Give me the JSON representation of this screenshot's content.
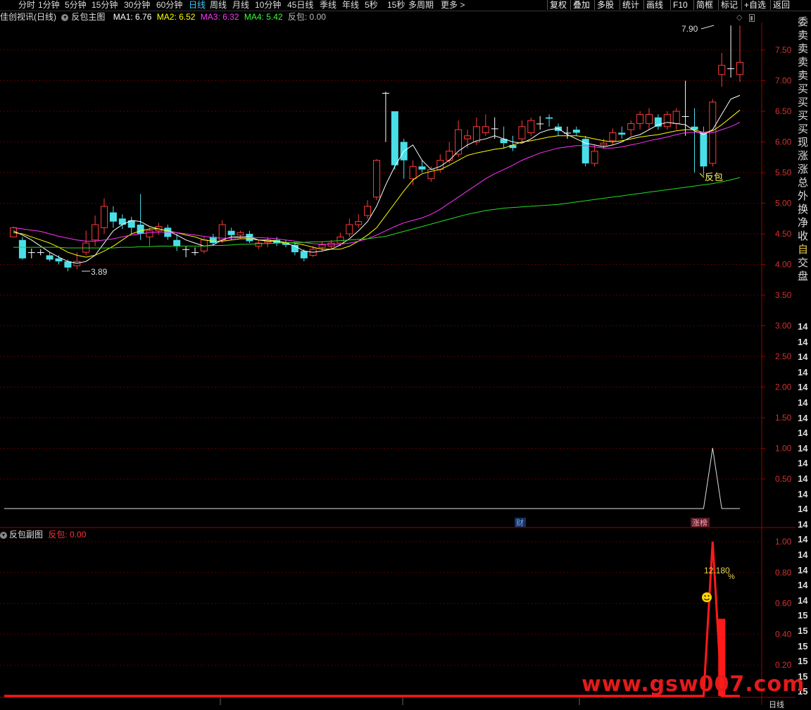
{
  "toolbar": {
    "periods": [
      {
        "label": "分时",
        "active": false
      },
      {
        "label": "1分钟",
        "active": false
      },
      {
        "label": "5分钟",
        "active": false
      },
      {
        "label": "15分钟",
        "active": false
      },
      {
        "label": "30分钟",
        "active": false
      },
      {
        "label": "60分钟",
        "active": false
      },
      {
        "label": "日线",
        "active": true
      },
      {
        "label": "周线",
        "active": false
      },
      {
        "label": "月线",
        "active": false
      },
      {
        "label": "10分钟",
        "active": false
      },
      {
        "label": "45日线",
        "active": false
      },
      {
        "label": "季线",
        "active": false
      },
      {
        "label": "年线",
        "active": false
      },
      {
        "label": "5秒",
        "active": false
      },
      {
        "label": "15秒",
        "active": false
      },
      {
        "label": "多周期",
        "active": false
      },
      {
        "label": "更多 >",
        "active": false
      }
    ],
    "actions": [
      "复权",
      "叠加",
      "多股",
      "统计",
      "画线",
      "F10",
      "简框",
      "标记",
      "+自选",
      "返回"
    ]
  },
  "main_title": {
    "stock": "佳创视讯(日线)",
    "indicator": "反包主图",
    "ma1": "MA1: 6.76",
    "ma2": "MA2: 6.52",
    "ma3": "MA3: 6.32",
    "ma4": "MA4: 5.42",
    "fanbao": "反包: 0.00"
  },
  "sub_title": {
    "indicator": "反包副图",
    "fanbao": "反包: 0.00"
  },
  "chart_data": [
    {
      "type": "candlestick",
      "title": "佳创视讯(日线)",
      "ylim": [
        0.0,
        8.0
      ],
      "y_ticks": [
        "7.50",
        "7.00",
        "6.50",
        "6.00",
        "5.50",
        "5.00",
        "4.50",
        "4.00",
        "3.50",
        "3.00",
        "2.50",
        "2.00",
        "1.50",
        "1.00",
        "0.50"
      ],
      "annotations": [
        {
          "text": "7.90",
          "type": "high"
        },
        {
          "text": "3.89",
          "type": "low"
        },
        {
          "text": "反包",
          "type": "signal"
        },
        {
          "text": "财",
          "type": "event"
        },
        {
          "text": "涨榜",
          "type": "event"
        }
      ],
      "candles": [
        [
          4.45,
          4.6,
          4.62,
          4.45
        ],
        [
          4.4,
          4.1,
          4.45,
          4.08
        ],
        [
          4.2,
          4.2,
          4.26,
          4.1
        ],
        [
          4.2,
          4.2,
          4.25,
          4.15
        ],
        [
          4.15,
          4.08,
          4.2,
          4.05
        ],
        [
          4.1,
          4.05,
          4.15,
          4.0
        ],
        [
          4.05,
          3.95,
          4.08,
          3.89
        ],
        [
          3.98,
          4.05,
          4.2,
          3.92
        ],
        [
          4.2,
          4.35,
          4.55,
          4.15
        ],
        [
          4.4,
          4.65,
          4.8,
          4.3
        ],
        [
          4.6,
          4.95,
          5.08,
          4.5
        ],
        [
          4.85,
          4.7,
          4.95,
          4.6
        ],
        [
          4.75,
          4.65,
          4.82,
          4.58
        ],
        [
          4.72,
          4.6,
          4.78,
          4.5
        ],
        [
          4.65,
          4.5,
          5.15,
          4.4
        ],
        [
          4.45,
          4.55,
          4.6,
          4.3
        ],
        [
          4.55,
          4.62,
          4.68,
          4.48
        ],
        [
          4.6,
          4.45,
          4.65,
          4.4
        ],
        [
          4.4,
          4.3,
          4.5,
          4.22
        ],
        [
          4.25,
          4.25,
          4.3,
          4.12
        ],
        [
          4.2,
          4.2,
          4.28,
          4.15
        ],
        [
          4.22,
          4.4,
          4.45,
          4.18
        ],
        [
          4.45,
          4.35,
          4.5,
          4.3
        ],
        [
          4.4,
          4.65,
          4.72,
          4.35
        ],
        [
          4.55,
          4.48,
          4.6,
          4.4
        ],
        [
          4.48,
          4.52,
          4.55,
          4.42
        ],
        [
          4.5,
          4.38,
          4.55,
          4.35
        ],
        [
          4.3,
          4.35,
          4.4,
          4.25
        ],
        [
          4.36,
          4.4,
          4.45,
          4.28
        ],
        [
          4.4,
          4.35,
          4.45,
          4.3
        ],
        [
          4.35,
          4.32,
          4.4,
          4.28
        ],
        [
          4.32,
          4.2,
          4.35,
          4.15
        ],
        [
          4.22,
          4.1,
          4.25,
          4.05
        ],
        [
          4.15,
          4.25,
          4.3,
          4.12
        ],
        [
          4.28,
          4.32,
          4.38,
          4.22
        ],
        [
          4.3,
          4.35,
          4.4,
          4.25
        ],
        [
          4.35,
          4.45,
          4.52,
          4.3
        ],
        [
          4.5,
          4.65,
          4.75,
          4.45
        ],
        [
          4.65,
          4.7,
          4.82,
          4.6
        ],
        [
          4.8,
          4.95,
          5.05,
          4.75
        ],
        [
          5.1,
          5.7,
          5.72,
          5.05
        ],
        [
          6.8,
          6.8,
          6.82,
          6.0
        ],
        [
          6.5,
          5.62,
          6.5,
          5.55
        ],
        [
          6.0,
          5.7,
          6.05,
          5.4
        ],
        [
          5.4,
          5.6,
          5.7,
          5.3
        ],
        [
          5.6,
          5.55,
          5.7,
          5.5
        ],
        [
          5.4,
          5.55,
          5.6,
          5.35
        ],
        [
          5.55,
          5.7,
          5.8,
          5.5
        ],
        [
          5.7,
          5.85,
          6.0,
          5.65
        ],
        [
          5.8,
          6.2,
          6.35,
          5.75
        ],
        [
          6.05,
          6.1,
          6.2,
          5.9
        ],
        [
          6.0,
          6.25,
          6.4,
          5.95
        ],
        [
          6.15,
          6.25,
          6.45,
          6.1
        ],
        [
          6.22,
          6.22,
          6.4,
          6.05
        ],
        [
          6.05,
          5.98,
          6.25,
          5.9
        ],
        [
          5.95,
          5.9,
          6.1,
          5.85
        ],
        [
          6.05,
          6.25,
          6.35,
          6.0
        ],
        [
          6.15,
          6.35,
          6.4,
          6.1
        ],
        [
          6.3,
          6.3,
          6.42,
          6.2
        ],
        [
          6.4,
          6.38,
          6.45,
          6.25
        ],
        [
          6.25,
          6.18,
          6.3,
          6.1
        ],
        [
          6.15,
          6.15,
          6.25,
          6.05
        ],
        [
          6.2,
          6.15,
          6.25,
          6.1
        ],
        [
          6.05,
          5.65,
          6.1,
          5.6
        ],
        [
          5.65,
          5.85,
          5.95,
          5.6
        ],
        [
          5.95,
          5.98,
          6.05,
          5.9
        ],
        [
          6.02,
          6.15,
          6.22,
          5.95
        ],
        [
          6.15,
          6.12,
          6.25,
          6.05
        ],
        [
          6.2,
          6.3,
          6.35,
          6.1
        ],
        [
          6.3,
          6.45,
          6.5,
          6.2
        ],
        [
          6.3,
          6.45,
          6.55,
          6.2
        ],
        [
          6.4,
          6.25,
          6.45,
          6.2
        ],
        [
          6.25,
          6.45,
          6.5,
          6.2
        ],
        [
          6.3,
          6.5,
          6.55,
          6.2
        ],
        [
          6.42,
          6.42,
          7.0,
          6.1
        ],
        [
          6.25,
          6.2,
          6.55,
          5.5
        ],
        [
          6.15,
          5.6,
          6.25,
          5.45
        ],
        [
          5.65,
          6.65,
          6.7,
          5.6
        ],
        [
          7.1,
          7.25,
          7.45,
          6.9
        ],
        [
          7.2,
          7.2,
          7.9,
          7.05
        ],
        [
          7.1,
          7.3,
          7.9,
          6.98
        ]
      ],
      "ma_lines": [
        {
          "name": "MA1",
          "color": "#ffffff"
        },
        {
          "name": "MA2",
          "color": "#ffff00"
        },
        {
          "name": "MA3",
          "color": "#ff00ff"
        },
        {
          "name": "MA4",
          "color": "#00ff00"
        }
      ],
      "ma1": [
        4.55,
        4.48,
        4.4,
        4.3,
        4.2,
        4.12,
        4.05,
        4.02,
        4.05,
        4.15,
        4.35,
        4.55,
        4.65,
        4.72,
        4.7,
        4.62,
        4.58,
        4.55,
        4.48,
        4.4,
        4.35,
        4.3,
        4.32,
        4.4,
        4.45,
        4.45,
        4.45,
        4.4,
        4.38,
        4.38,
        4.35,
        4.3,
        4.22,
        4.2,
        4.22,
        4.25,
        4.32,
        4.42,
        4.55,
        4.7,
        4.95,
        5.3,
        5.6,
        5.85,
        5.95,
        5.7,
        5.55,
        5.6,
        5.7,
        5.85,
        5.95,
        6.02,
        6.05,
        6.1,
        6.05,
        6.0,
        5.98,
        6.05,
        6.15,
        6.2,
        6.22,
        6.12,
        6.05,
        5.98,
        5.95,
        5.92,
        5.95,
        6.0,
        6.08,
        6.12,
        6.2,
        6.28,
        6.32,
        6.3,
        6.28,
        6.18,
        6.12,
        6.2,
        6.45,
        6.7,
        6.76
      ],
      "ma2": [
        4.52,
        4.5,
        4.45,
        4.4,
        4.35,
        4.28,
        4.2,
        4.15,
        4.12,
        4.15,
        4.22,
        4.3,
        4.4,
        4.5,
        4.55,
        4.58,
        4.58,
        4.55,
        4.52,
        4.48,
        4.45,
        4.4,
        4.38,
        4.38,
        4.4,
        4.42,
        4.42,
        4.4,
        4.4,
        4.38,
        4.36,
        4.35,
        4.32,
        4.28,
        4.25,
        4.25,
        4.25,
        4.3,
        4.38,
        4.48,
        4.6,
        4.8,
        5.0,
        5.2,
        5.38,
        5.48,
        5.52,
        5.55,
        5.62,
        5.7,
        5.78,
        5.82,
        5.85,
        5.88,
        5.9,
        5.95,
        6.0,
        6.02,
        6.05,
        6.08,
        6.1,
        6.1,
        6.1,
        6.08,
        6.05,
        6.02,
        6.0,
        6.02,
        6.05,
        6.08,
        6.1,
        6.12,
        6.15,
        6.18,
        6.2,
        6.2,
        6.15,
        6.18,
        6.28,
        6.4,
        6.52
      ],
      "ma3": [
        4.6,
        4.58,
        4.56,
        4.54,
        4.5,
        4.46,
        4.43,
        4.4,
        4.38,
        4.38,
        4.4,
        4.42,
        4.45,
        4.48,
        4.5,
        4.52,
        4.53,
        4.53,
        4.52,
        4.5,
        4.48,
        4.46,
        4.44,
        4.43,
        4.43,
        4.44,
        4.44,
        4.44,
        4.43,
        4.42,
        4.4,
        4.38,
        4.36,
        4.34,
        4.33,
        4.33,
        4.33,
        4.35,
        4.38,
        4.42,
        4.48,
        4.55,
        4.62,
        4.68,
        4.72,
        4.76,
        4.82,
        4.9,
        5.0,
        5.1,
        5.2,
        5.3,
        5.4,
        5.48,
        5.55,
        5.62,
        5.7,
        5.76,
        5.82,
        5.86,
        5.9,
        5.92,
        5.94,
        5.94,
        5.92,
        5.9,
        5.9,
        5.92,
        5.95,
        5.98,
        6.02,
        6.05,
        6.08,
        6.12,
        6.15,
        6.16,
        6.15,
        6.15,
        6.2,
        6.25,
        6.32
      ],
      "ma4": [
        4.28,
        4.28,
        4.28,
        4.28,
        4.28,
        4.28,
        4.27,
        4.27,
        4.27,
        4.27,
        4.27,
        4.27,
        4.28,
        4.28,
        4.29,
        4.29,
        4.3,
        4.3,
        4.3,
        4.3,
        4.3,
        4.3,
        4.31,
        4.31,
        4.32,
        4.33,
        4.33,
        4.34,
        4.34,
        4.35,
        4.35,
        4.36,
        4.36,
        4.37,
        4.37,
        4.38,
        4.39,
        4.4,
        4.41,
        4.42,
        4.44,
        4.46,
        4.5,
        4.54,
        4.58,
        4.62,
        4.66,
        4.7,
        4.74,
        4.78,
        4.82,
        4.85,
        4.88,
        4.9,
        4.92,
        4.93,
        4.94,
        4.95,
        4.96,
        4.97,
        4.98,
        5.0,
        5.02,
        5.04,
        5.06,
        5.08,
        5.1,
        5.12,
        5.14,
        5.16,
        5.18,
        5.2,
        5.22,
        5.24,
        5.26,
        5.28,
        5.3,
        5.32,
        5.35,
        5.38,
        5.42
      ],
      "signal_series_main": "0 everywhere except index 77 = 1.00"
    },
    {
      "type": "line",
      "title": "反包副图",
      "ylim": [
        0.0,
        1.1
      ],
      "y_ticks": [
        "1.00",
        "0.80",
        "0.60",
        "0.40",
        "0.20"
      ],
      "signal_peak_index": 77,
      "signal_value": 1.0,
      "bar_index": 78,
      "bar_value": 0.5,
      "annotations": [
        {
          "text": "12.180",
          "suffix": "%"
        }
      ]
    }
  ],
  "right_panel": {
    "items": [
      {
        "label": "委",
        "color": "#dddddd"
      },
      {
        "label": "卖",
        "color": "#dddddd"
      },
      {
        "label": "卖",
        "color": "#dddddd"
      },
      {
        "label": "卖",
        "color": "#dddddd"
      },
      {
        "label": "卖",
        "color": "#dddddd"
      },
      {
        "label": "买",
        "color": "#dddddd"
      },
      {
        "label": "买",
        "color": "#dddddd"
      },
      {
        "label": "买",
        "color": "#dddddd"
      },
      {
        "label": "买",
        "color": "#dddddd"
      },
      {
        "label": "现",
        "color": "#dddddd"
      },
      {
        "label": "涨",
        "color": "#dddddd"
      },
      {
        "label": "涨",
        "color": "#dddddd"
      },
      {
        "label": "总",
        "color": "#dddddd"
      },
      {
        "label": "外",
        "color": "#dddddd"
      },
      {
        "label": "换",
        "color": "#dddddd"
      },
      {
        "label": "净",
        "color": "#dddddd"
      },
      {
        "label": "收",
        "color": "#dddddd"
      },
      {
        "label": "自",
        "color": "#e6c84a"
      },
      {
        "label": "交",
        "color": "#dddddd"
      },
      {
        "label": "盘",
        "color": "#dddddd"
      }
    ],
    "times": [
      "14",
      "14",
      "14",
      "14",
      "14",
      "14",
      "14",
      "14",
      "14",
      "14",
      "14",
      "14",
      "14",
      "14",
      "14",
      "14",
      "14",
      "14",
      "14",
      "15",
      "15",
      "15",
      "15",
      "15",
      "15"
    ]
  },
  "bottom": {
    "period": "日线"
  },
  "watermark": "www.gsw007.com",
  "colors": {
    "up": "#ff3b3b",
    "down": "#48e0e8",
    "grid": "#5a0000",
    "axis": "#a00000",
    "accent": "#3ec8ff"
  }
}
